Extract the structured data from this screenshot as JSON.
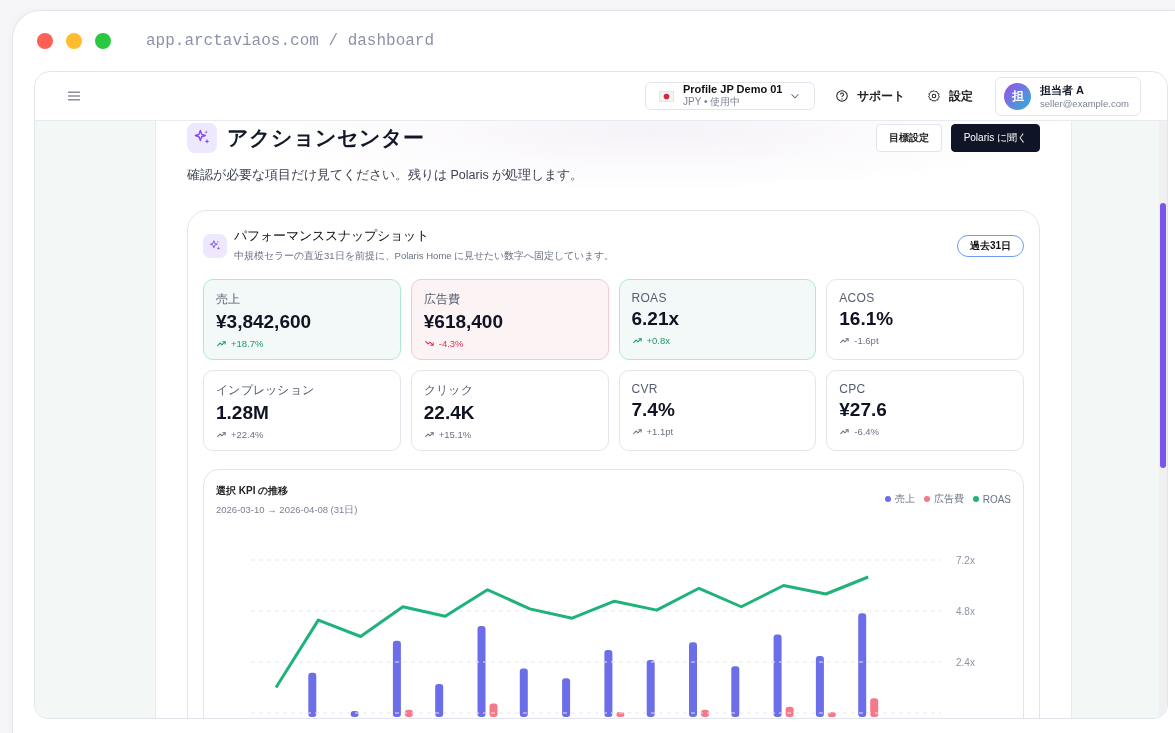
{
  "window": {
    "address": "app.arctaviaos.com / dashboard"
  },
  "header": {
    "profile": {
      "name": "Profile JP Demo 01",
      "detail": "JPY • 使用中"
    },
    "links": [
      {
        "kind": "help",
        "label": "サポート"
      },
      {
        "kind": "settings",
        "label": "設定"
      }
    ],
    "user": {
      "avatar": "担",
      "name": "担当者 A",
      "email": "seller@example.com"
    }
  },
  "page": {
    "title": "アクションセンター",
    "subtitle": "確認が必要な項目だけ見てください。残りは Polaris が処理します。",
    "buttons": [
      {
        "label": "目標設定",
        "kind": "secondary"
      },
      {
        "label": "Polaris に聞く",
        "kind": "primary"
      }
    ]
  },
  "snapshot": {
    "title": "パフォーマンススナップショット",
    "description": "中規模セラーの直近31日を前提に、Polaris Home に見せたい数字へ固定しています。",
    "period": "過去31日",
    "kpis": [
      {
        "label": "売上",
        "value": "¥3,842,600",
        "delta": "+18.7%",
        "kind": "good",
        "down": false
      },
      {
        "label": "広告費",
        "value": "¥618,400",
        "delta": "-4.3%",
        "kind": "bad",
        "down": true
      },
      {
        "label": "ROAS",
        "value": "6.21x",
        "delta": "+0.8x",
        "kind": "good",
        "down": false
      },
      {
        "label": "ACOS",
        "value": "16.1%",
        "delta": "-1.6pt",
        "kind": "plain",
        "down": false
      },
      {
        "label": "インプレッション",
        "value": "1.28M",
        "delta": "+22.4%",
        "kind": "plain",
        "down": false
      },
      {
        "label": "クリック",
        "value": "22.4K",
        "delta": "+15.1%",
        "kind": "plain",
        "down": false
      },
      {
        "label": "CVR",
        "value": "7.4%",
        "delta": "+1.1pt",
        "kind": "plain",
        "down": false
      },
      {
        "label": "CPC",
        "value": "¥27.6",
        "delta": "-6.4%",
        "kind": "plain",
        "down": false
      }
    ],
    "trend": {
      "title": "選択 KPI の推移",
      "range": "2026-03-10 → 2026-04-08 (31日)",
      "legend": [
        {
          "name": "売上",
          "color": "#6b6ee8"
        },
        {
          "name": "広告費",
          "color": "#f47a8a"
        }
      ],
      "line": {
        "chart_data": {
          "type": "line",
          "categories": [
            null,
            null,
            null,
            null,
            null,
            null,
            null,
            null,
            null,
            null,
            null,
            null,
            null,
            null,
            null
          ],
          "yticks": [
            {
              "value": 2.4,
              "label": "2.4x"
            },
            {
              "value": 4.8,
              "label": "4.8x"
            },
            {
              "value": 7.2,
              "label": "7.2x"
            }
          ],
          "ylim": [
            0,
            7.2
          ],
          "series": [
            {
              "name": "ROAS",
              "color": "#1fb27a",
              "values": [
                1.2,
                4.37,
                3.6,
                5.0,
                4.55,
                5.8,
                4.9,
                4.46,
                5.26,
                4.84,
                5.87,
                5.0,
                6.0,
                5.6,
                6.4
              ]
            }
          ]
        }
      }
    }
  }
}
